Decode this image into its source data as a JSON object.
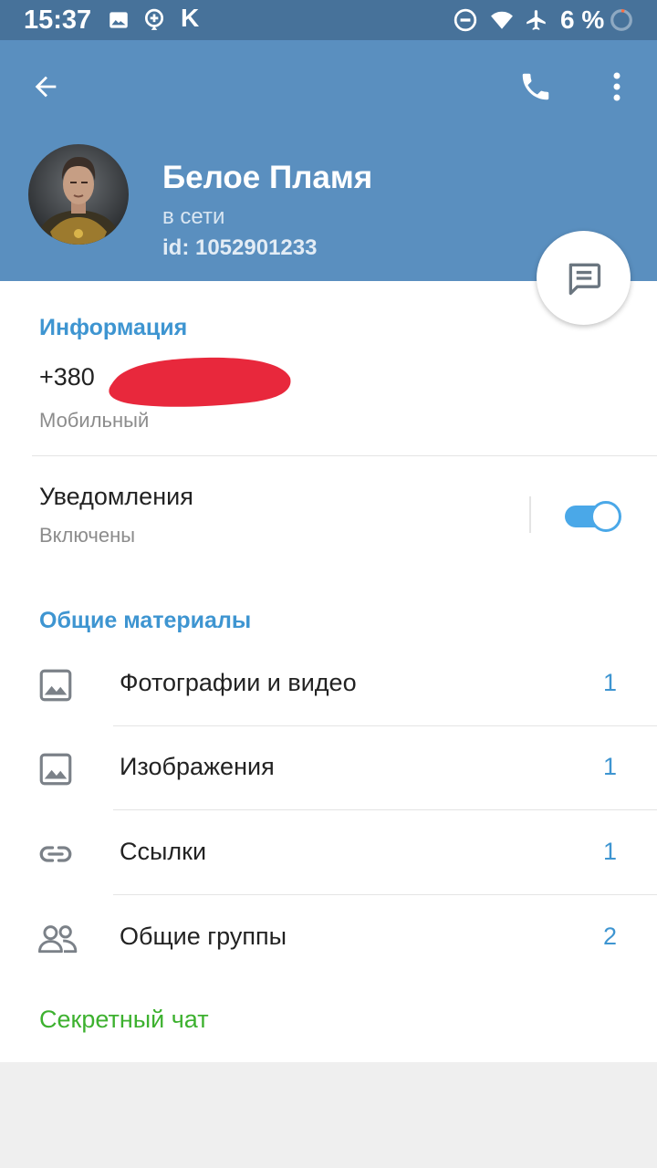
{
  "status_bar": {
    "time": "15:37",
    "battery": "6 %",
    "icons": [
      "image-icon",
      "location-pin-icon",
      "k-app-icon",
      "do-not-disturb-icon",
      "wifi-icon",
      "airplane-icon",
      "battery-ring-icon"
    ],
    "letter_icon": "K"
  },
  "header": {
    "name": "Белое Пламя",
    "status": "в сети",
    "user_id": "id: 1052901233",
    "bg_color": "#5a8fbf"
  },
  "info": {
    "section_title": "Информация",
    "phone": "+380",
    "phone_type": "Мобильный"
  },
  "notifications": {
    "title": "Уведомления",
    "state": "Включены",
    "enabled": true
  },
  "media": {
    "section_title": "Общие материалы",
    "items": [
      {
        "label": "Фотографии и видео",
        "count": "1",
        "icon": "photo-icon"
      },
      {
        "label": "Изображения",
        "count": "1",
        "icon": "image-icon"
      },
      {
        "label": "Ссылки",
        "count": "1",
        "icon": "link-icon"
      },
      {
        "label": "Общие группы",
        "count": "2",
        "icon": "groups-icon"
      }
    ]
  },
  "secret_chat": "Секретный чат",
  "colors": {
    "accent": "#3e95d1",
    "green": "#3db12f",
    "redaction": "#e8283c"
  }
}
